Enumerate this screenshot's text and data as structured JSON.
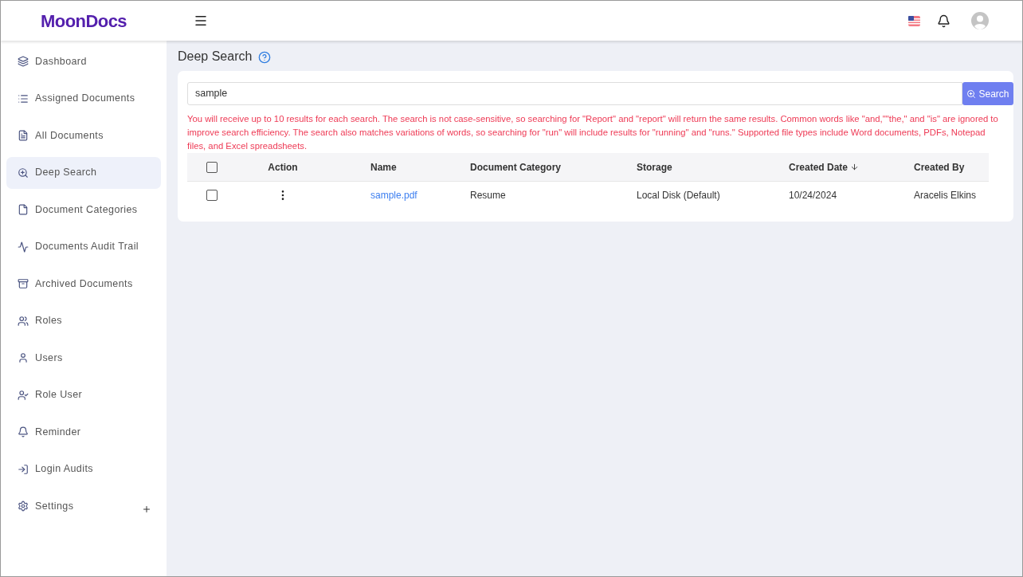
{
  "header": {
    "logo": "MoonDocs"
  },
  "sidebar": {
    "items": [
      {
        "label": "Dashboard",
        "selected": false
      },
      {
        "label": "Assigned Documents",
        "selected": false
      },
      {
        "label": "All Documents",
        "selected": false
      },
      {
        "label": "Deep Search",
        "selected": true
      },
      {
        "label": "Document Categories",
        "selected": false
      },
      {
        "label": "Documents Audit Trail",
        "selected": false
      },
      {
        "label": "Archived Documents",
        "selected": false
      },
      {
        "label": "Roles",
        "selected": false
      },
      {
        "label": "Users",
        "selected": false
      },
      {
        "label": "Role User",
        "selected": false
      },
      {
        "label": "Reminder",
        "selected": false
      },
      {
        "label": "Login Audits",
        "selected": false
      },
      {
        "label": "Settings",
        "selected": false,
        "expanded": false
      }
    ]
  },
  "page": {
    "title": "Deep Search"
  },
  "search": {
    "value": "sample",
    "button": "Search"
  },
  "notice": "You will receive up to 10 results for each search. The search is not case-sensitive, so searching for \"Report\" and \"report\" will return the same results. Common words like \"and,\"\"the,\" and \"is\" are ignored to improve search efficiency. The search also matches variations of words, so searching for \"run\" will include results for \"running\" and \"runs.\" Supported file types include Word documents, PDFs, Notepad files, and Excel spreadsheets.",
  "table": {
    "select_all_checked": false,
    "columns": [
      {
        "label": "Action",
        "sorted": false
      },
      {
        "label": "Name",
        "sorted": false
      },
      {
        "label": "Document Category",
        "sorted": false
      },
      {
        "label": "Storage",
        "sorted": false
      },
      {
        "label": "Created Date",
        "sorted": true
      },
      {
        "label": "Created By",
        "sorted": false
      }
    ],
    "rows": [
      {
        "checked": false,
        "name": "sample.pdf",
        "category": "Resume",
        "storage": "Local Disk (Default)",
        "created_date": "10/24/2024",
        "created_by": "Aracelis Elkins"
      }
    ]
  }
}
